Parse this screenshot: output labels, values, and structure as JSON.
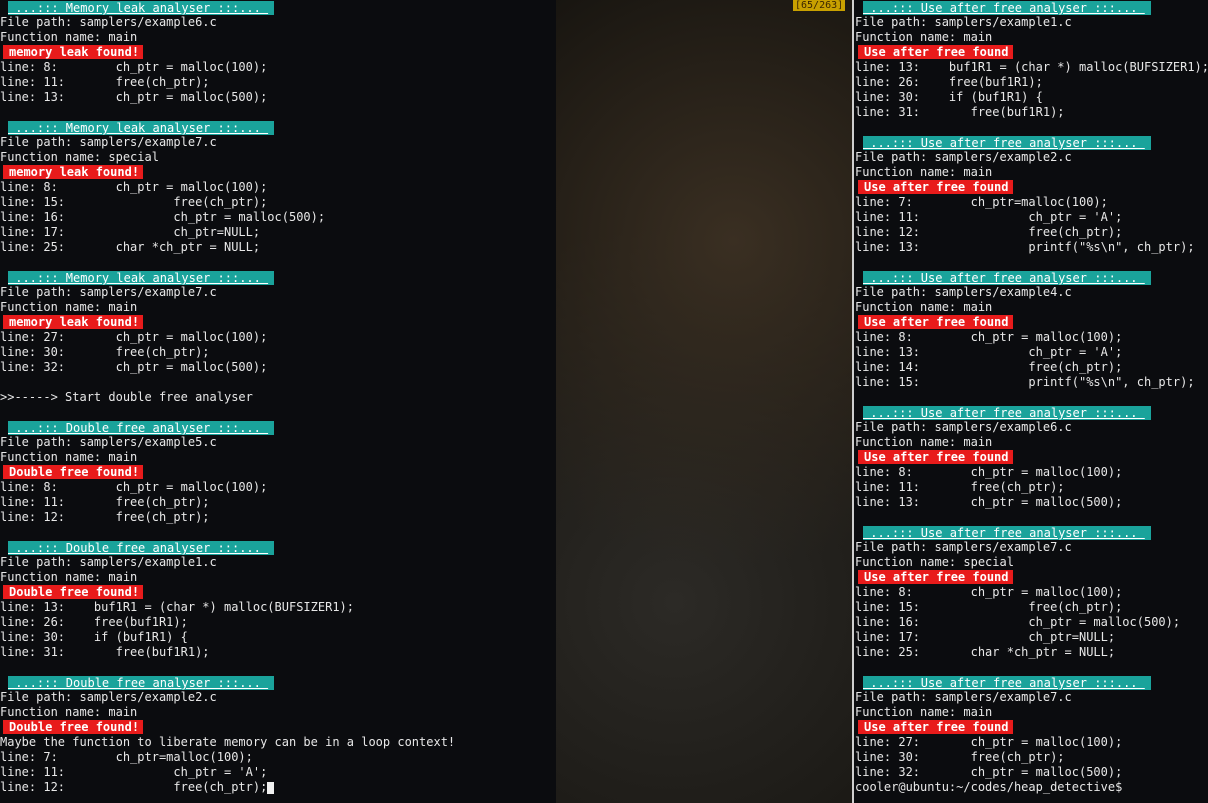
{
  "status_counter": "[65/263]",
  "left_panel": {
    "reports": [
      {
        "header": " ...::: Memory leak analyser :::... ",
        "file": "File path: samplers/example6.c",
        "function": "Function name: main",
        "alert": "memory leak found!",
        "lines": [
          "line: 8:        ch_ptr = malloc(100);",
          "line: 11:       free(ch_ptr);",
          "line: 13:       ch_ptr = malloc(500);"
        ]
      },
      {
        "header": " ...::: Memory leak analyser :::... ",
        "file": "File path: samplers/example7.c",
        "function": "Function name: special",
        "alert": "memory leak found!",
        "lines": [
          "line: 8:        ch_ptr = malloc(100);",
          "line: 15:               free(ch_ptr);",
          "line: 16:               ch_ptr = malloc(500);",
          "line: 17:               ch_ptr=NULL;",
          "line: 25:       char *ch_ptr = NULL;"
        ]
      },
      {
        "header": " ...::: Memory leak analyser :::... ",
        "file": "File path: samplers/example7.c",
        "function": "Function name: main",
        "alert": "memory leak found!",
        "lines": [
          "line: 27:       ch_ptr = malloc(100);",
          "line: 30:       free(ch_ptr);",
          "line: 32:       ch_ptr = malloc(500);"
        ]
      }
    ],
    "start_message": ">>-----> Start double free analyser",
    "double_free_reports": [
      {
        "header": " ...::: Double free analyser :::... ",
        "file": "File path: samplers/example5.c",
        "function": "Function name: main",
        "alert": "Double free found!",
        "lines": [
          "line: 8:        ch_ptr = malloc(100);",
          "line: 11:       free(ch_ptr);",
          "line: 12:       free(ch_ptr);"
        ]
      },
      {
        "header": " ...::: Double free analyser :::... ",
        "file": "File path: samplers/example1.c",
        "function": "Function name: main",
        "alert": "Double free found!",
        "lines": [
          "line: 13:    buf1R1 = (char *) malloc(BUFSIZER1);",
          "line: 26:    free(buf1R1);",
          "line: 30:    if (buf1R1) {",
          "line: 31:       free(buf1R1);"
        ]
      },
      {
        "header": " ...::: Double free analyser :::... ",
        "file": "File path: samplers/example2.c",
        "function": "Function name: main",
        "alert": "Double free found!",
        "note": "Maybe the function to liberate memory can be in a loop context!",
        "lines": [
          "line: 7:        ch_ptr=malloc(100);",
          "line: 11:               ch_ptr = 'A';",
          "line: 12:               free(ch_ptr);"
        ]
      }
    ]
  },
  "right_panel": {
    "reports": [
      {
        "header": " ...::: Use after free analyser :::... ",
        "file": "File path: samplers/example1.c",
        "function": "Function name: main",
        "alert": "Use after free found",
        "lines": [
          "line: 13:    buf1R1 = (char *) malloc(BUFSIZER1);",
          "line: 26:    free(buf1R1);",
          "line: 30:    if (buf1R1) {",
          "line: 31:       free(buf1R1);"
        ]
      },
      {
        "header": " ...::: Use after free analyser :::... ",
        "file": "File path: samplers/example2.c",
        "function": "Function name: main",
        "alert": "Use after free found",
        "lines": [
          "line: 7:        ch_ptr=malloc(100);",
          "line: 11:               ch_ptr = 'A';",
          "line: 12:               free(ch_ptr);",
          "line: 13:               printf(\"%s\\n\", ch_ptr);"
        ]
      },
      {
        "header": " ...::: Use after free analyser :::... ",
        "file": "File path: samplers/example4.c",
        "function": "Function name: main",
        "alert": "Use after free found",
        "lines": [
          "line: 8:        ch_ptr = malloc(100);",
          "line: 13:               ch_ptr = 'A';",
          "line: 14:               free(ch_ptr);",
          "line: 15:               printf(\"%s\\n\", ch_ptr);"
        ]
      },
      {
        "header": " ...::: Use after free analyser :::... ",
        "file": "File path: samplers/example6.c",
        "function": "Function name: main",
        "alert": "Use after free found",
        "lines": [
          "line: 8:        ch_ptr = malloc(100);",
          "line: 11:       free(ch_ptr);",
          "line: 13:       ch_ptr = malloc(500);"
        ]
      },
      {
        "header": " ...::: Use after free analyser :::... ",
        "file": "File path: samplers/example7.c",
        "function": "Function name: special",
        "alert": "Use after free found",
        "lines": [
          "line: 8:        ch_ptr = malloc(100);",
          "line: 15:               free(ch_ptr);",
          "line: 16:               ch_ptr = malloc(500);",
          "line: 17:               ch_ptr=NULL;",
          "line: 25:       char *ch_ptr = NULL;"
        ]
      },
      {
        "header": " ...::: Use after free analyser :::... ",
        "file": "File path: samplers/example7.c",
        "function": "Function name: main",
        "alert": "Use after free found",
        "lines": [
          "line: 27:       ch_ptr = malloc(100);",
          "line: 30:       free(ch_ptr);",
          "line: 32:       ch_ptr = malloc(500);"
        ]
      }
    ],
    "prompt": "cooler@ubuntu:~/codes/heap_detective$"
  }
}
